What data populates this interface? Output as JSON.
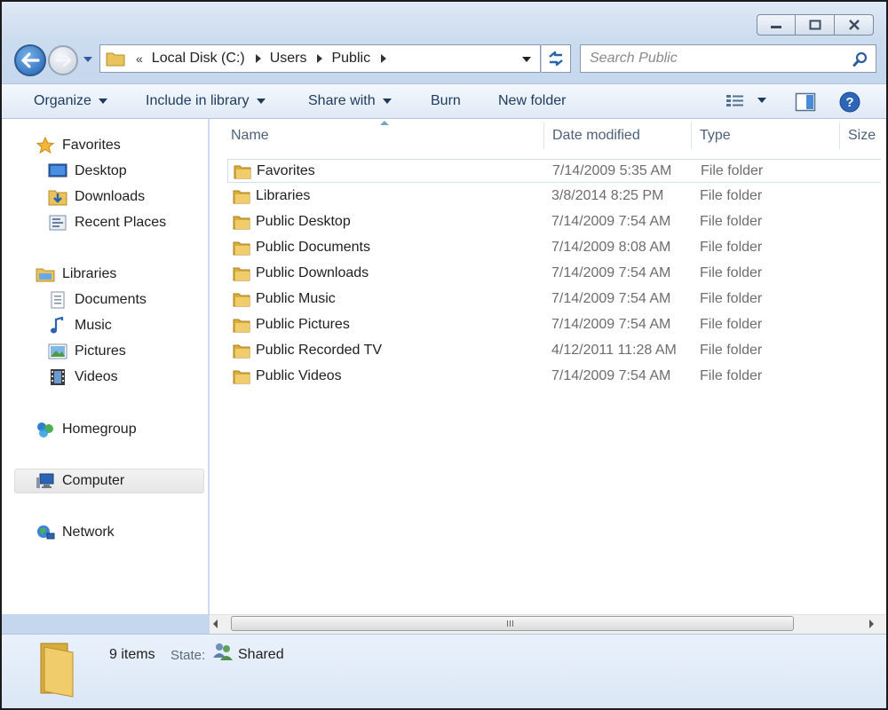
{
  "address": {
    "overflow": "«",
    "crumbs": [
      "Local Disk (C:)",
      "Users",
      "Public"
    ]
  },
  "search": {
    "placeholder": "Search Public"
  },
  "toolbar": {
    "organize": "Organize",
    "include": "Include in library",
    "share": "Share with",
    "burn": "Burn",
    "new_folder": "New folder"
  },
  "sidebar": {
    "favorites": {
      "label": "Favorites",
      "icon": "star-icon",
      "items": [
        {
          "label": "Desktop",
          "icon": "desktop-icon"
        },
        {
          "label": "Downloads",
          "icon": "downloads-icon"
        },
        {
          "label": "Recent Places",
          "icon": "recent-places-icon"
        }
      ]
    },
    "libraries": {
      "label": "Libraries",
      "icon": "libraries-icon",
      "items": [
        {
          "label": "Documents",
          "icon": "documents-icon"
        },
        {
          "label": "Music",
          "icon": "music-icon"
        },
        {
          "label": "Pictures",
          "icon": "pictures-icon"
        },
        {
          "label": "Videos",
          "icon": "videos-icon"
        }
      ]
    },
    "homegroup": {
      "label": "Homegroup",
      "icon": "homegroup-icon"
    },
    "computer": {
      "label": "Computer",
      "icon": "computer-icon"
    },
    "network": {
      "label": "Network",
      "icon": "network-icon"
    }
  },
  "columns": {
    "name": "Name",
    "date": "Date modified",
    "type": "Type",
    "size": "Size"
  },
  "files": [
    {
      "name": "Favorites",
      "date": "7/14/2009 5:35 AM",
      "type": "File folder"
    },
    {
      "name": "Libraries",
      "date": "3/8/2014 8:25 PM",
      "type": "File folder"
    },
    {
      "name": "Public Desktop",
      "date": "7/14/2009 7:54 AM",
      "type": "File folder"
    },
    {
      "name": "Public Documents",
      "date": "7/14/2009 8:08 AM",
      "type": "File folder"
    },
    {
      "name": "Public Downloads",
      "date": "7/14/2009 7:54 AM",
      "type": "File folder"
    },
    {
      "name": "Public Music",
      "date": "7/14/2009 7:54 AM",
      "type": "File folder"
    },
    {
      "name": "Public Pictures",
      "date": "7/14/2009 7:54 AM",
      "type": "File folder"
    },
    {
      "name": "Public Recorded TV",
      "date": "4/12/2011 11:28 AM",
      "type": "File folder"
    },
    {
      "name": "Public Videos",
      "date": "7/14/2009 7:54 AM",
      "type": "File folder"
    }
  ],
  "details": {
    "count": "9 items",
    "state_label": "State:",
    "state_value": "Shared"
  },
  "colors": {
    "accent": "#1d5fb0",
    "folder": "#e8c25a",
    "toolbar_text": "#1e3a5f"
  }
}
